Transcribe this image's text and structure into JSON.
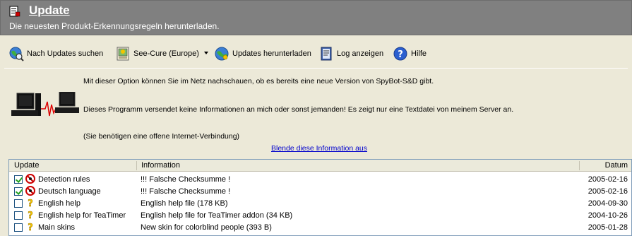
{
  "header": {
    "title": "Update",
    "subtitle": "Die neuesten Produkt-Erkennungsregeln herunterladen."
  },
  "toolbar": {
    "search_updates": "Nach Updates suchen",
    "mirror": "See-Cure (Europe)",
    "download": "Updates herunterladen",
    "log": "Log anzeigen",
    "help": "Hilfe"
  },
  "info": {
    "line1": "Mit dieser Option können Sie im Netz nachschauen, ob es bereits eine neue Version von SpyBot-S&D gibt.",
    "line2": "Dieses Programm versendet keine Informationen an mich oder sonst jemanden! Es zeigt nur eine Textdatei von meinem Server an.",
    "line3": "(Sie benötigen eine offene Internet-Verbindung)",
    "hide_link": "Blende diese Information aus"
  },
  "table": {
    "columns": {
      "update": "Update",
      "information": "Information",
      "date": "Datum"
    },
    "rows": [
      {
        "checked": true,
        "status": "error",
        "update": "Detection rules",
        "information": "!!! Falsche Checksumme !",
        "date": "2005-02-16"
      },
      {
        "checked": true,
        "status": "error",
        "update": "Deutsch language",
        "information": "!!! Falsche Checksumme !",
        "date": "2005-02-16"
      },
      {
        "checked": false,
        "status": "unknown",
        "update": "English help",
        "information": "English help file (178 KB)",
        "date": "2004-09-30"
      },
      {
        "checked": false,
        "status": "unknown",
        "update": "English help for TeaTimer",
        "information": "English help file for TeaTimer addon (34 KB)",
        "date": "2004-10-26"
      },
      {
        "checked": false,
        "status": "unknown",
        "update": "Main skins",
        "information": "New skin for colorblind people (393 B)",
        "date": "2005-01-28"
      }
    ]
  },
  "colors": {
    "header_bg": "#808080",
    "window_bg": "#ece9d8",
    "link": "#0000cc",
    "error_red": "#cc0000",
    "question_yellow": "#f2c500"
  },
  "icons": {
    "app": "spybot-document-icon",
    "search_updates": "globe-search-icon",
    "mirror": "server-picture-icon",
    "download": "globe-download-icon",
    "log": "log-book-icon",
    "help": "help-question-icon",
    "error": "error-no-entry-icon",
    "unknown": "question-mark-icon"
  }
}
